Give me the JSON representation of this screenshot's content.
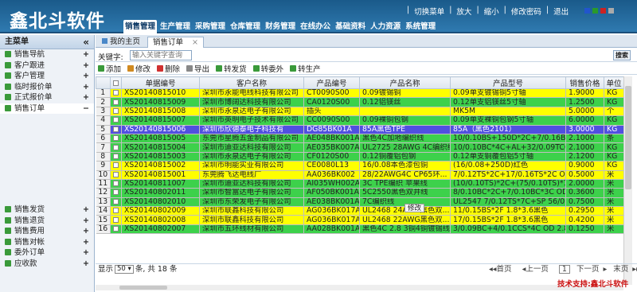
{
  "app": {
    "logo": "鑫北斗软件"
  },
  "nav": {
    "items": [
      "销售管理",
      "生产管理",
      "采购管理",
      "仓库管理",
      "财务管理",
      "在线办公",
      "基础资料",
      "人力资源",
      "系统管理"
    ],
    "active": 0
  },
  "toplinks": [
    "切换菜单",
    "放大",
    "缩小",
    "修改密码",
    "退出"
  ],
  "sidebar": {
    "title": "主菜单",
    "collapse": "«",
    "items": [
      {
        "label": "销售导航",
        "pm": "+"
      },
      {
        "label": "客户跟进",
        "pm": "+"
      },
      {
        "label": "客户管理",
        "pm": "+"
      },
      {
        "label": "临时报价单",
        "pm": "+"
      },
      {
        "label": "正式报价单",
        "pm": "+"
      },
      {
        "label": "销售订单",
        "pm": "−"
      }
    ],
    "items2": [
      {
        "label": "销售发货",
        "pm": "+"
      },
      {
        "label": "销售退货",
        "pm": "+"
      },
      {
        "label": "销售费用",
        "pm": "+"
      },
      {
        "label": "销售对帐",
        "pm": "+"
      },
      {
        "label": "委外订单",
        "pm": "+"
      },
      {
        "label": "应收款",
        "pm": "+"
      }
    ]
  },
  "tabs": {
    "home": "我的主页",
    "current": "销售订单"
  },
  "search": {
    "label": "关键字:",
    "placeholder": "输入关键字查询",
    "button": "搜索"
  },
  "toolbar": [
    {
      "label": "添加",
      "color": "#3a9a3a"
    },
    {
      "label": "修改",
      "color": "#d08a20"
    },
    {
      "label": "删除",
      "color": "#d03030"
    },
    {
      "label": "导出",
      "color": "#888888"
    },
    {
      "label": "转发货",
      "color": "#3a9a3a"
    },
    {
      "label": "转委外",
      "color": "#3a9a3a"
    },
    {
      "label": "转生产",
      "color": "#3a9a3a"
    }
  ],
  "grid": {
    "headers": [
      "",
      "",
      "单据编号",
      "客户名称",
      "产品编号",
      "产品名称",
      "产品型号",
      "销售价格",
      "单位"
    ],
    "rows": [
      {
        "n": "1",
        "bg": "#ffff00",
        "c": [
          "XS20140815010",
          "深圳市永能电线科技有限公司",
          "CT0090S00",
          "0.09镀锡铜",
          "0.09单支镀锡铜5寸轴",
          "1.9000",
          "KG"
        ]
      },
      {
        "n": "2",
        "bg": "#3dd14b",
        "c": [
          "XS20140815009",
          "深圳市博阔达科技有限公司",
          "CA0120S00",
          "0.12铝镁丝",
          "0.12单支铝镁丝5寸轴",
          "1.2500",
          "KG"
        ]
      },
      {
        "n": "3",
        "bg": "#ffff00",
        "c": [
          "XS20140815008",
          "深圳市永泉达电子有限公司",
          "插头",
          "",
          "MK5M",
          "5.0000",
          "个"
        ]
      },
      {
        "n": "4",
        "bg": "#3dd14b",
        "c": [
          "XS20140815007",
          "深圳市英明电子技术有限公司",
          "CC0090S00",
          "0.09裸铜包钢",
          "0.09单支裸铜包钢5寸轴",
          "6.0000",
          "KG"
        ]
      },
      {
        "n": "5",
        "bg": "#5050e0",
        "c": [
          "XS20140815006",
          "深圳市欣德泰电子科技有",
          "DG85BK01A",
          "85A黑色TPE",
          "85A（黑色2101）",
          "3.0000",
          "KG"
        ]
      },
      {
        "n": "6",
        "bg": "#3dd14b",
        "c": [
          "XS20140815005",
          "东莞市星腾五金制品有限公司",
          "AE048BK001A",
          "黑色4C加地编织线",
          "10/0.10BS+150D*2C+7/0.16BS+150...",
          "2.1000",
          "条"
        ]
      },
      {
        "n": "7",
        "bg": "#3dd14b",
        "c": [
          "XS20140815004",
          "深圳市迪亚达科技有限公司",
          "AE035BK007A",
          "UL2725 28AWG 4C编织线",
          "10/0.10BC*4C+AL+32/0.09TCCS编...",
          "2.1000",
          "KG"
        ]
      },
      {
        "n": "8",
        "bg": "#3dd14b",
        "c": [
          "XS20140815003",
          "深圳市永泉达电子有限公司",
          "CF0120S00",
          "0.12铜覆铝包钢",
          "0.12单支铜覆包铝5寸轴",
          "2.1200",
          "KG"
        ]
      },
      {
        "n": "9",
        "bg": "#ffff00",
        "c": [
          "XS20140815002",
          "深圳市明能实业有限公司",
          "CE0080L13",
          "16/0.08本色漆包铜",
          "(16/0.08+250D)红色",
          "0.9000",
          "KG"
        ]
      },
      {
        "n": "10",
        "bg": "#ffff00",
        "c": [
          "XS20140815001",
          "东莞腾飞达电线厂",
          "AA036BK002",
          "28/22AWG4C CP65环...",
          "7/0.12TS*2C+17/0.16TS*2C OD 3.6m...",
          "0.5000",
          "米"
        ]
      },
      {
        "n": "11",
        "bg": "#3dd14b",
        "c": [
          "XS20140811007",
          "深圳市迪亚达科技有限公司",
          "AI035WH002A",
          "3C TPE编织 苹果线",
          "(10/0.10TS)*2C+(75/0.10TS)*1C+150...",
          "2.0000",
          "米"
        ]
      },
      {
        "n": "12",
        "bg": "#3dd14b",
        "c": [
          "XS20140802011",
          "深圳市智富达电子有限公司",
          "AF050BK001A",
          "5C2550黑色双并线",
          "8/0.10BC*2C+7/0.10BC*3C OD2.5*5...",
          "0.3600",
          "米"
        ]
      },
      {
        "n": "13",
        "bg": "#3dd14b",
        "c": [
          "XS20140802010",
          "深圳市东荣发电子有限公司",
          "AE038BK001A",
          "7C编织线",
          "UL2547 7/0.12TS*7C+SP 56/0.10TC...",
          "0.7500",
          "米"
        ]
      },
      {
        "n": "14",
        "bg": "#ffff00",
        "c": [
          "XS20140802009",
          "深圳市联鑫科技有限公司",
          "AG036BK017A",
          "UL2468 24AWG黑色双...",
          "11/0.15BS*2F 1.8*3.6黑色",
          "0.2950",
          "米"
        ]
      },
      {
        "n": "15",
        "bg": "#ffff00",
        "c": [
          "XS20140802008",
          "深圳市联鑫科技有限公司",
          "AG036BK017A",
          "UL2468 22AWG黑色双...",
          "17/0.15BS*2F 1.8*3.6黑色",
          "0.4200",
          "米"
        ]
      },
      {
        "n": "16",
        "bg": "#3dd14b",
        "c": [
          "XS20140802007",
          "深圳市五环线材有限公司",
          "AA028BK001A",
          "黑色4C 2.8 3铜4铜镀锡线",
          "3/0.09BC+4/0.1CCS*4C OD 2.8黑色",
          "0.1250",
          "米"
        ]
      }
    ],
    "tooltip": "修改"
  },
  "pager": {
    "show": "显示",
    "size": "50",
    "unit": "条, 共 18 条",
    "first": "首页",
    "prev": "上一页",
    "page": "1",
    "next": "下一页",
    "last": "末页",
    "go": "转"
  },
  "footer": {
    "support": "技术支持:鑫北斗软件"
  }
}
